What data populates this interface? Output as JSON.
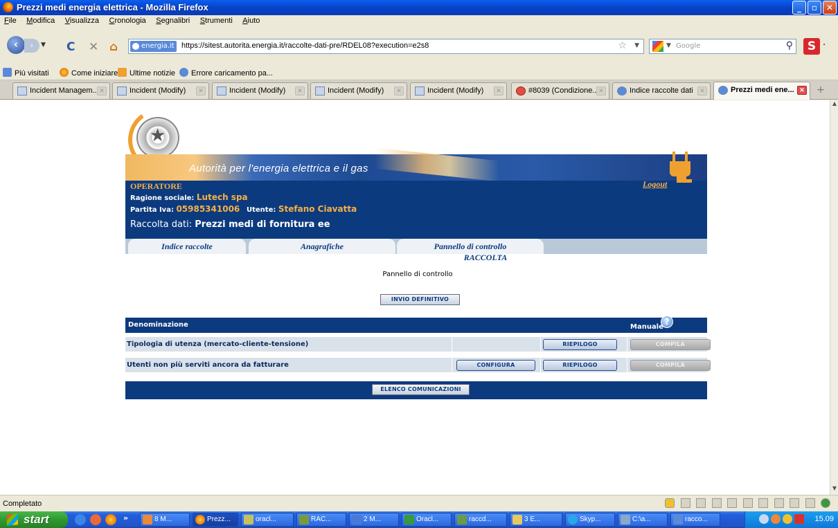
{
  "window": {
    "title": "Prezzi medi energia elettrica - Mozilla Firefox",
    "buttons": [
      "_",
      "▫",
      "✕"
    ]
  },
  "menu": [
    "File",
    "Modifica",
    "Visualizza",
    "Cronologia",
    "Segnalibri",
    "Strumenti",
    "Aiuto"
  ],
  "navbar": {
    "back_glyph": "‹",
    "forward_glyph": "›",
    "reload_glyph": "C",
    "stop_glyph": "✕",
    "home_glyph": "⌂",
    "site_badge": "energia.it",
    "url": "https://sitest.autorita.energia.it/raccolte-dati-pre/RDEL08?execution=e2s8",
    "search_placeholder": "Google",
    "skype_glyph": "S"
  },
  "bookmarks": [
    "Più visitati",
    "Come iniziare",
    "Ultime notizie",
    "Errore caricamento pa..."
  ],
  "tabs": [
    {
      "label": "Incident Managem...",
      "active": false
    },
    {
      "label": "Incident (Modify)",
      "active": false
    },
    {
      "label": "Incident (Modify)",
      "active": false
    },
    {
      "label": "Incident (Modify)",
      "active": false
    },
    {
      "label": "Incident (Modify)",
      "active": false
    },
    {
      "label": "#8039 (Condizione...",
      "active": false
    },
    {
      "label": "Indice raccolte dati",
      "active": false
    },
    {
      "label": "Prezzi medi ene...",
      "active": true
    }
  ],
  "page": {
    "agency_name": "Autorità per l'energia elettrica e il gas",
    "operator_title": "OPERATORE",
    "logout": "Logout",
    "ragione_label": "Ragione sociale:",
    "ragione_value": "Lutech spa",
    "piva_label": "Partita Iva:",
    "piva_value": "05985341006",
    "utente_label": "Utente:",
    "utente_value": "Stefano Ciavatta",
    "raccolta_label": "Raccolta dati:",
    "raccolta_value": "Prezzi medi di fornitura ee",
    "app_tabs": [
      "Indice raccolte",
      "Anagrafiche",
      "Pannello di controllo"
    ],
    "subtitle": "RACCOLTA",
    "pannello_label": "Pannello di controllo",
    "invio_button": "INVIO DEFINITIVO",
    "table": {
      "col_denominazione": "Denominazione",
      "col_manuale": "Manuale",
      "help_glyph": "?",
      "rows": [
        {
          "label": "Tipologia di utenza (mercato-cliente-tensione)",
          "configura": "",
          "riepilogo": "RIEPILOGO",
          "compila": "COMPILA"
        },
        {
          "label": "Utenti non più serviti ancora da fatturare",
          "configura": "CONFIGURA",
          "riepilogo": "RIEPILOGO",
          "compila": "COMPILA"
        }
      ]
    },
    "elenco_button": "ELENCO COMUNICAZIONI"
  },
  "status": "Completato",
  "taskbar": {
    "start": "start",
    "more": "»",
    "items": [
      "8 M...",
      "Prezz...",
      "oracl...",
      "RAC...",
      "2 M...",
      "Oracl...",
      "raccd...",
      "3 E...",
      "Skyp...",
      "C:\\a...",
      "racco..."
    ],
    "clock": "15.09"
  },
  "colors": {
    "header_blue": "#0c3a7e",
    "accent_orange": "#f7b047"
  }
}
